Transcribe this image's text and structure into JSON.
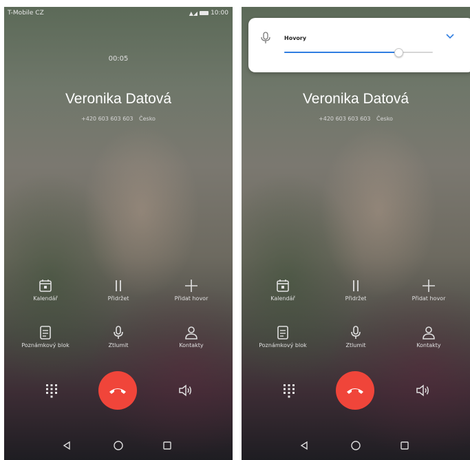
{
  "left_screen": {
    "status": {
      "carrier": "T-Mobile CZ",
      "time": "10:00"
    },
    "call": {
      "duration": "00:05",
      "name": "Veronika Datová",
      "number": "+420 603 603 603",
      "country": "Česko"
    },
    "actions": [
      {
        "label": "Kalendář",
        "icon": "calendar-icon"
      },
      {
        "label": "Přidržet",
        "icon": "pause-icon"
      },
      {
        "label": "Přidat hovor",
        "icon": "plus-icon"
      },
      {
        "label": "Poznámkový blok",
        "icon": "notepad-icon"
      },
      {
        "label": "Ztlumit",
        "icon": "microphone-icon"
      },
      {
        "label": "Kontakty",
        "icon": "contact-icon"
      }
    ]
  },
  "right_screen": {
    "volume_panel": {
      "label": "Hovory",
      "level_percent": 77,
      "icon": "microphone-icon",
      "expand_icon": "chevron-down-icon"
    },
    "call": {
      "name": "Veronika Datová",
      "number": "+420 603 603 603",
      "country": "Česko"
    },
    "actions": [
      {
        "label": "Kalendář",
        "icon": "calendar-icon"
      },
      {
        "label": "Přidržet",
        "icon": "pause-icon"
      },
      {
        "label": "Přidat hovor",
        "icon": "plus-icon"
      },
      {
        "label": "Poznámkový blok",
        "icon": "notepad-icon"
      },
      {
        "label": "Ztlumit",
        "icon": "microphone-icon"
      },
      {
        "label": "Kontakty",
        "icon": "contact-icon"
      }
    ]
  },
  "colors": {
    "end_call": "#f0453a",
    "volume_accent": "#2f7de1"
  }
}
